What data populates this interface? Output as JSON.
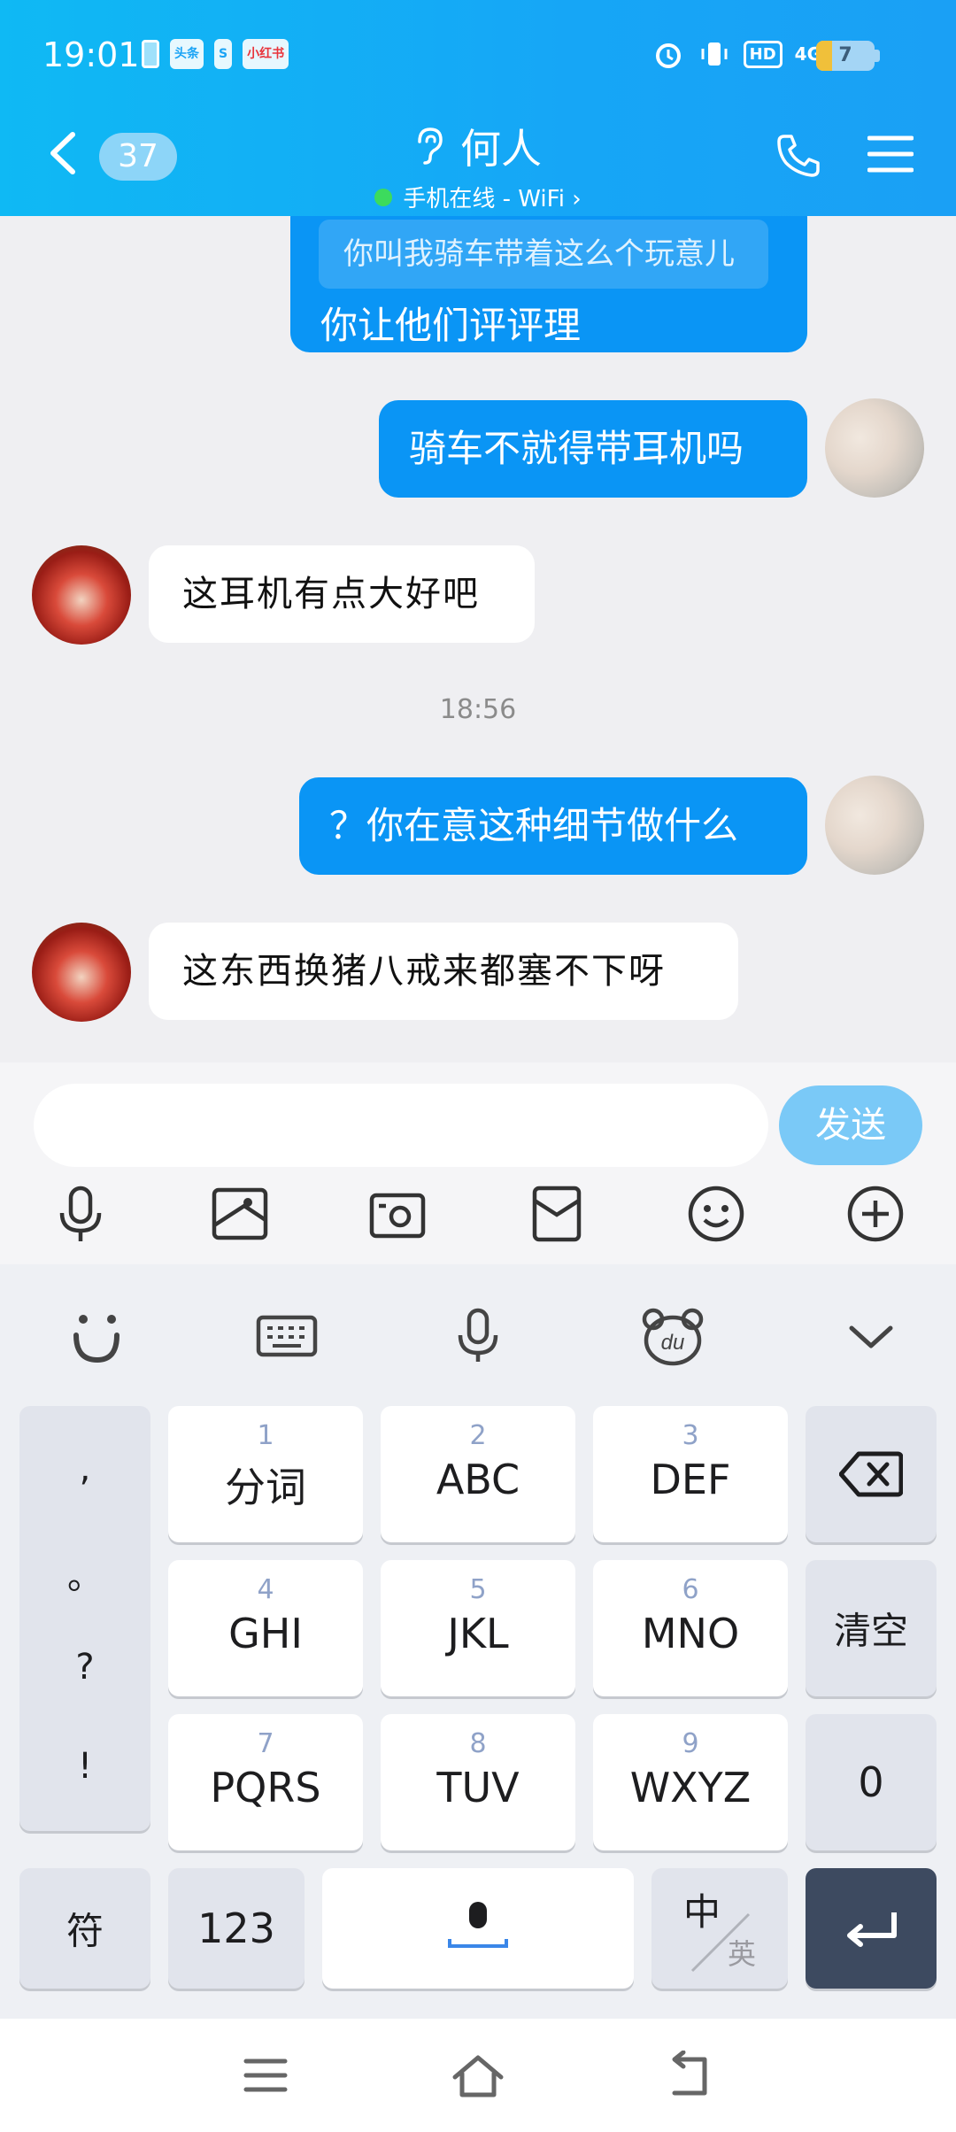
{
  "status_bar": {
    "time": "19:01",
    "app_badges": [
      "头条",
      "S",
      "小红书"
    ],
    "network": "4G",
    "hd": "HD",
    "battery": "7"
  },
  "header": {
    "unread_count": "37",
    "contact_name": "何人",
    "online_status": "手机在线 - WiFi ›"
  },
  "messages": {
    "quote_text": "你叫我骑车带着这么个玩意儿",
    "m1": "你让他们评评理",
    "m2": "骑车不就得带耳机吗",
    "m3": "这耳机有点大好吧",
    "time_divider": "18:56",
    "m4": "？你在意这种细节做什么",
    "m5": "这东西换猪八戒来都塞不下呀"
  },
  "input": {
    "placeholder": "",
    "send_label": "发送"
  },
  "keyboard": {
    "punct": [
      ",",
      "。",
      "?",
      "!"
    ],
    "keys": [
      {
        "num": "1",
        "label": "分词"
      },
      {
        "num": "2",
        "label": "ABC"
      },
      {
        "num": "3",
        "label": "DEF"
      },
      {
        "num": "4",
        "label": "GHI"
      },
      {
        "num": "5",
        "label": "JKL"
      },
      {
        "num": "6",
        "label": "MNO"
      },
      {
        "num": "7",
        "label": "PQRS"
      },
      {
        "num": "8",
        "label": "TUV"
      },
      {
        "num": "9",
        "label": "WXYZ"
      }
    ],
    "clear_label": "清空",
    "zero_label": "0",
    "symbol_label": "符",
    "numeric_label": "123",
    "lang_main": "中",
    "lang_alt": "英"
  },
  "colors": {
    "header_bg": "#16a6f6",
    "my_bubble": "#0a95f5",
    "send_button": "#7ac9f7",
    "enter_key": "#3d4a60"
  }
}
